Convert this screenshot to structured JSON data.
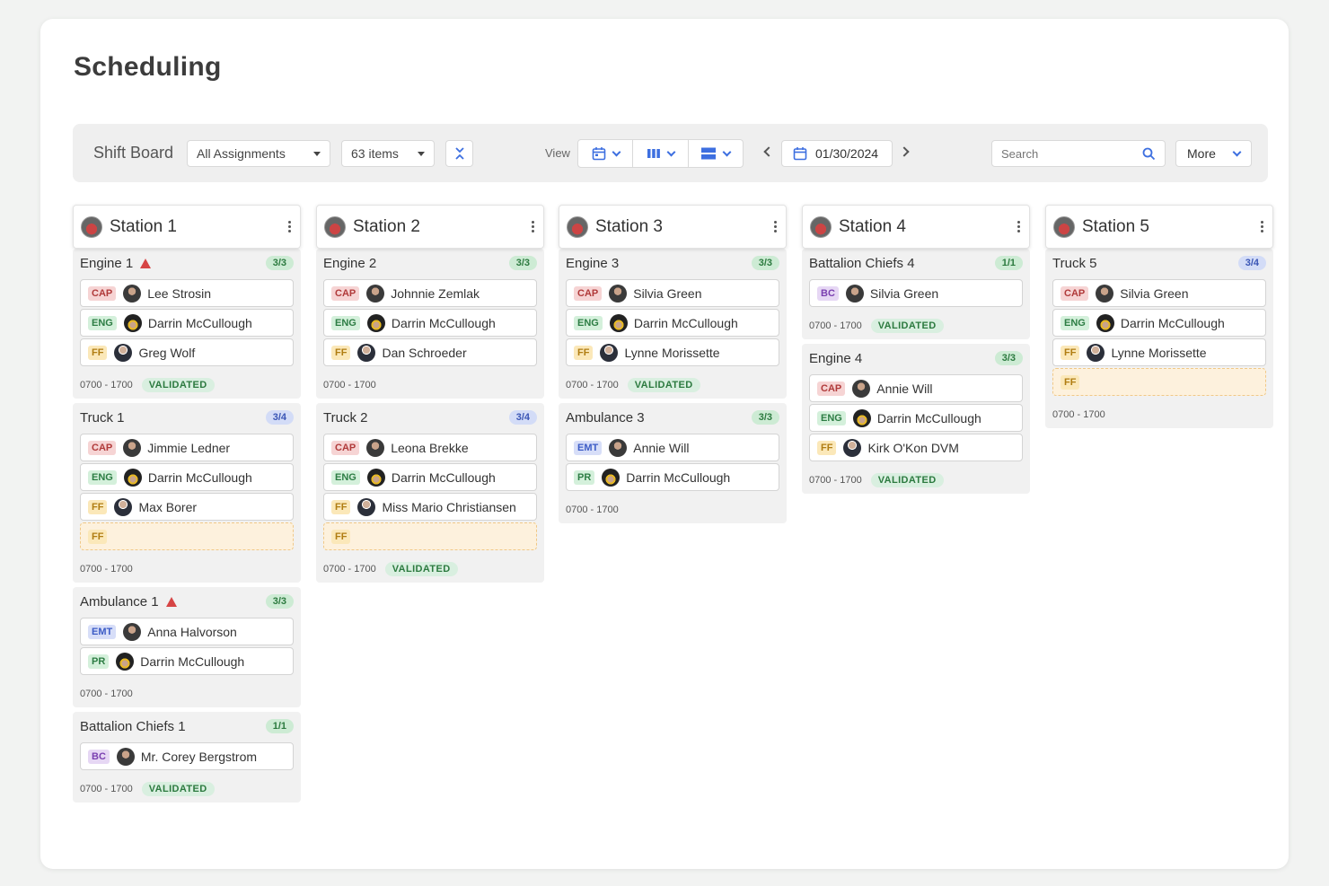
{
  "page": {
    "title": "Scheduling"
  },
  "toolbar": {
    "board_label": "Shift Board",
    "assignments_select": "All Assignments",
    "items_select": "63 items",
    "view_label": "View",
    "date": "01/30/2024",
    "search_placeholder": "Search",
    "more_label": "More"
  },
  "stations": [
    {
      "name": "Station 1",
      "units": [
        {
          "name": "Engine 1",
          "warning": true,
          "count": "3/3",
          "count_color": "green",
          "slots": [
            {
              "role": "CAP",
              "person": "Lee Strosin"
            },
            {
              "role": "ENG",
              "person": "Darrin McCullough"
            },
            {
              "role": "FF",
              "person": "Greg Wolf"
            }
          ],
          "time": "0700 - 1700",
          "status": "VALIDATED"
        },
        {
          "name": "Truck 1",
          "warning": false,
          "count": "3/4",
          "count_color": "blue",
          "slots": [
            {
              "role": "CAP",
              "person": "Jimmie Ledner"
            },
            {
              "role": "ENG",
              "person": "Darrin McCullough"
            },
            {
              "role": "FF",
              "person": "Max Borer"
            },
            {
              "role": "FF",
              "person": ""
            }
          ],
          "time": "0700 - 1700",
          "status": ""
        },
        {
          "name": "Ambulance 1",
          "warning": true,
          "count": "3/3",
          "count_color": "green",
          "slots": [
            {
              "role": "EMT",
              "person": "Anna Halvorson"
            },
            {
              "role": "PR",
              "person": "Darrin McCullough"
            }
          ],
          "time": "0700 - 1700",
          "status": ""
        },
        {
          "name": "Battalion Chiefs 1",
          "warning": false,
          "count": "1/1",
          "count_color": "green",
          "slots": [
            {
              "role": "BC",
              "person": "Mr. Corey Bergstrom"
            }
          ],
          "time": "0700 - 1700",
          "status": "VALIDATED"
        }
      ]
    },
    {
      "name": "Station 2",
      "units": [
        {
          "name": "Engine 2",
          "warning": false,
          "count": "3/3",
          "count_color": "green",
          "slots": [
            {
              "role": "CAP",
              "person": "Johnnie Zemlak"
            },
            {
              "role": "ENG",
              "person": "Darrin McCullough"
            },
            {
              "role": "FF",
              "person": "Dan Schroeder"
            }
          ],
          "time": "0700 - 1700",
          "status": ""
        },
        {
          "name": "Truck 2",
          "warning": false,
          "count": "3/4",
          "count_color": "blue",
          "slots": [
            {
              "role": "CAP",
              "person": "Leona Brekke"
            },
            {
              "role": "ENG",
              "person": "Darrin McCullough"
            },
            {
              "role": "FF",
              "person": "Miss Mario Christiansen"
            },
            {
              "role": "FF",
              "person": ""
            }
          ],
          "time": "0700 - 1700",
          "status": "VALIDATED"
        }
      ]
    },
    {
      "name": "Station 3",
      "units": [
        {
          "name": "Engine 3",
          "warning": false,
          "count": "3/3",
          "count_color": "green",
          "slots": [
            {
              "role": "CAP",
              "person": "Silvia Green"
            },
            {
              "role": "ENG",
              "person": "Darrin McCullough"
            },
            {
              "role": "FF",
              "person": "Lynne Morissette"
            }
          ],
          "time": "0700 - 1700",
          "status": "VALIDATED"
        },
        {
          "name": "Ambulance 3",
          "warning": false,
          "count": "3/3",
          "count_color": "green",
          "slots": [
            {
              "role": "EMT",
              "person": "Annie Will"
            },
            {
              "role": "PR",
              "person": "Darrin McCullough"
            }
          ],
          "time": "0700 - 1700",
          "status": ""
        }
      ]
    },
    {
      "name": "Station 4",
      "units": [
        {
          "name": "Battalion Chiefs 4",
          "warning": false,
          "count": "1/1",
          "count_color": "green",
          "slots": [
            {
              "role": "BC",
              "person": "Silvia Green"
            }
          ],
          "time": "0700 - 1700",
          "status": "VALIDATED"
        },
        {
          "name": "Engine 4",
          "warning": false,
          "count": "3/3",
          "count_color": "green",
          "slots": [
            {
              "role": "CAP",
              "person": "Annie Will"
            },
            {
              "role": "ENG",
              "person": "Darrin McCullough"
            },
            {
              "role": "FF",
              "person": "Kirk O'Kon DVM"
            }
          ],
          "time": "0700 - 1700",
          "status": "VALIDATED"
        }
      ]
    },
    {
      "name": "Station 5",
      "units": [
        {
          "name": "Truck 5",
          "warning": false,
          "count": "3/4",
          "count_color": "blue",
          "slots": [
            {
              "role": "CAP",
              "person": "Silvia Green"
            },
            {
              "role": "ENG",
              "person": "Darrin McCullough"
            },
            {
              "role": "FF",
              "person": "Lynne Morissette"
            },
            {
              "role": "FF",
              "person": ""
            }
          ],
          "time": "0700 - 1700",
          "status": ""
        }
      ]
    }
  ]
}
